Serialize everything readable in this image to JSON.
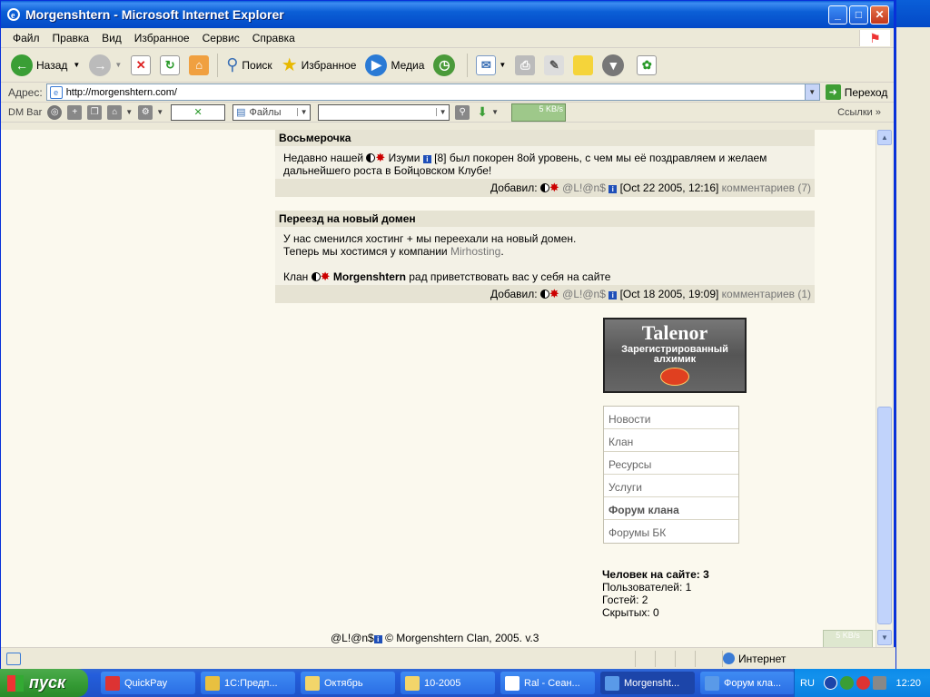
{
  "window": {
    "title": "Morgenshtern - Microsoft Internet Explorer",
    "minimize": "_",
    "maximize": "□",
    "close": "✕"
  },
  "menu": [
    "Файл",
    "Правка",
    "Вид",
    "Избранное",
    "Сервис",
    "Справка"
  ],
  "toolbar": {
    "back": "Назад",
    "search": "Поиск",
    "favorites": "Избранное",
    "media": "Медиа"
  },
  "address": {
    "label": "Адрес:",
    "url": "http://morgenshtern.com/",
    "go": "Переход"
  },
  "dmbar": {
    "label": "DM Bar",
    "files": "Файлы",
    "speed": "5 KB/s",
    "links": "Ссылки"
  },
  "news": [
    {
      "title": "Восьмерочка",
      "body_before": "Недавно нашей",
      "member": "Изуми",
      "body_after": "[8] был покорен 8ой уровень, с чем мы её поздравляем и желаем дальнейшего роста в Бойцовском Клубе!",
      "added_label": "Добавил:",
      "author": "@L!@n$",
      "date": "[Oct 22 2005, 12:16]",
      "comments": "комментариев (7)"
    },
    {
      "title": "Переезд на новый домен",
      "line1": "У нас сменился хостинг + мы переехали на новый домен.",
      "line2_before": "Теперь мы хостимся у компании",
      "hosting": "Mirhosting",
      "line2_after": ".",
      "line3_before": "Клан",
      "clan": "Morgenshtern",
      "line3_after": "рад приветствовать вас у себя на сайте",
      "added_label": "Добавил:",
      "author": "@L!@n$",
      "date": "[Oct 18 2005, 19:09]",
      "comments": "комментариев (1)"
    }
  ],
  "banner": {
    "title": "Talenor",
    "subtitle1": "Зарегистрированный",
    "subtitle2": "алхимик"
  },
  "nav": [
    "Новости",
    "Клан",
    "Ресурсы",
    "Услуги",
    "Форум клана",
    "Форумы БК"
  ],
  "online": {
    "header": "Человек на сайте: 3",
    "users": "Пользователей: 1",
    "guests": "Гостей: 2",
    "hidden": "Скрытых: 0"
  },
  "footer": {
    "author": "@L!@n$",
    "copyright": "© Morgenshtern Clan, 2005. v.3"
  },
  "mini_speed": "5 KB/s",
  "status": {
    "zone": "Интернет"
  },
  "taskbar": {
    "start": "пуск",
    "items": [
      "QuickPay",
      "1С:Предп...",
      "Октябрь",
      "10-2005",
      "Ral - Сеан...",
      "Morgensht...",
      "Форум кла..."
    ],
    "active_index": 5,
    "lang": "RU",
    "clock": "12:20"
  },
  "colors": {
    "title_bar": "#0a5fd8",
    "page_bg": "#fbf9ee",
    "news_header_bg": "#e6e3d3",
    "news_body_bg": "#f3f1e6",
    "taskbar": "#245edc",
    "start": "#339933"
  }
}
